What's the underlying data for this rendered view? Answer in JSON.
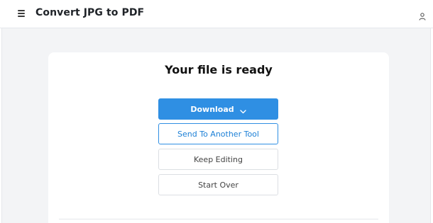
{
  "header": {
    "title": "Convert JPG to PDF",
    "menu_icon": "hamburger-menu-icon",
    "user_icon": "user-icon"
  },
  "result": {
    "heading": "Your file is ready",
    "download_label": "Download",
    "download_icon": "chevron-down-icon",
    "send_label": "Send To Another Tool",
    "keep_label": "Keep Editing",
    "start_label": "Start Over"
  },
  "colors": {
    "accent": "#2f8fe3",
    "page_bg": "#f3f4f6",
    "card_bg": "#ffffff"
  }
}
